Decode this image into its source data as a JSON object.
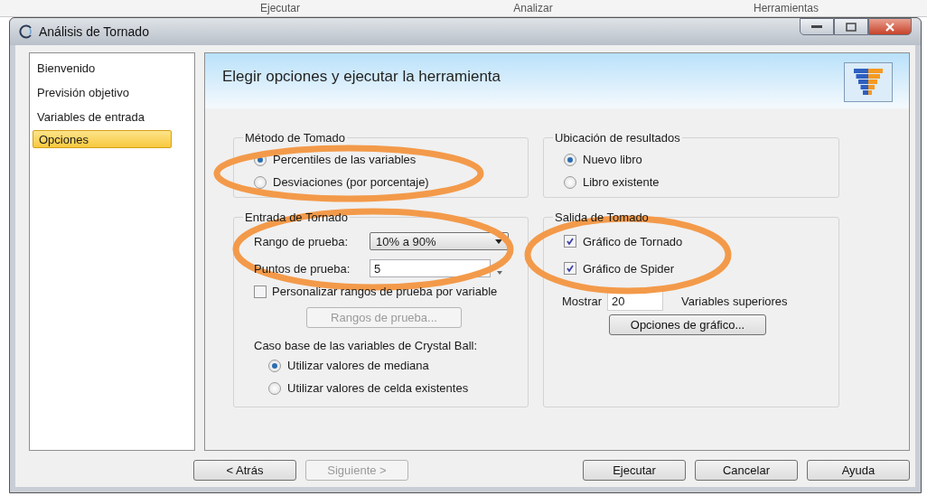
{
  "background_tabs": [
    "Ejecutar",
    "Analizar",
    "Herramientas"
  ],
  "window": {
    "title": "Análisis de Tornado"
  },
  "sidebar": {
    "items": [
      {
        "label": "Bienvenido",
        "selected": false
      },
      {
        "label": "Previsión objetivo",
        "selected": false
      },
      {
        "label": "Variables de entrada",
        "selected": false
      },
      {
        "label": "Opciones",
        "selected": true
      }
    ]
  },
  "header": {
    "title": "Elegir opciones y ejecutar la herramienta"
  },
  "tornado_method": {
    "legend": "Método de Tomado",
    "options": [
      {
        "label": "Percentiles de las variables",
        "selected": true
      },
      {
        "label": "Desviaciones (por porcentaje)",
        "selected": false
      }
    ]
  },
  "results_location": {
    "legend": "Ubicación de resultados",
    "options": [
      {
        "label": "Nuevo libro",
        "selected": true
      },
      {
        "label": "Libro existente",
        "selected": false
      }
    ]
  },
  "tornado_input": {
    "legend": "Entrada de Tornado",
    "test_range": {
      "label": "Rango de prueba:",
      "value": "10% a 90%"
    },
    "test_points": {
      "label": "Puntos de prueba:",
      "value": "5"
    },
    "customize": {
      "label": "Personalizar rangos de prueba por variable",
      "checked": false
    },
    "ranges_button": {
      "label": "Rangos de prueba...",
      "disabled": true
    },
    "base_case": {
      "label": "Caso base de las variables de Crystal Ball:",
      "options": [
        {
          "label": "Utilizar valores de mediana",
          "selected": true
        },
        {
          "label": "Utilizar valores de celda existentes",
          "selected": false
        }
      ]
    }
  },
  "tornado_output": {
    "legend": "Salida de Tomado",
    "checks": [
      {
        "label": "Gráfico de Tornado",
        "checked": true
      },
      {
        "label": "Gráfico de Spider",
        "checked": true
      }
    ],
    "show": {
      "label": "Mostrar",
      "value": "20",
      "suffix": "Variables superiores"
    },
    "chart_options_button": {
      "label": "Opciones de gráfico..."
    }
  },
  "buttons": [
    {
      "label": "< Atrás",
      "disabled": false
    },
    {
      "label": "Siguiente >",
      "disabled": true
    },
    {
      "label": "Ejecutar",
      "disabled": false
    },
    {
      "label": "Cancelar",
      "disabled": false
    },
    {
      "label": "Ayuda",
      "disabled": false
    }
  ]
}
